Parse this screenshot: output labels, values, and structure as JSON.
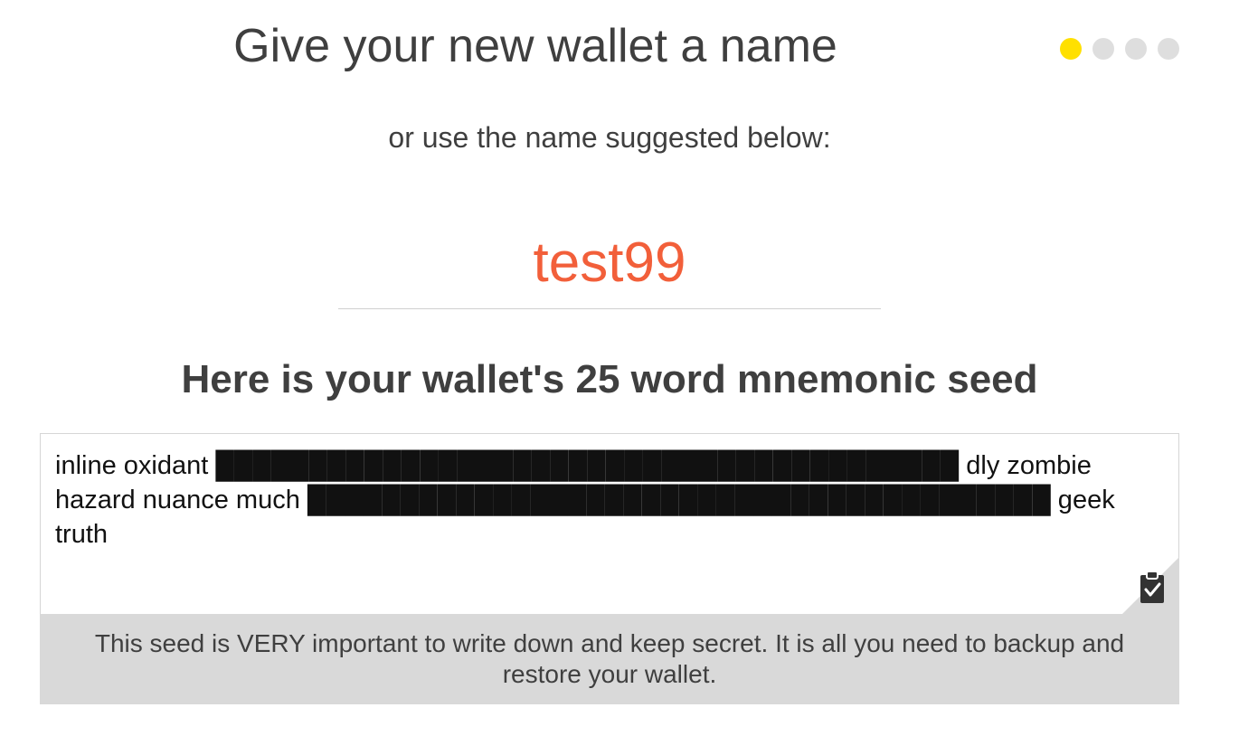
{
  "header": {
    "title": "Give your new wallet a name",
    "subtitle": "or use the name suggested below:"
  },
  "progress": {
    "total_steps": 4,
    "current_step": 1,
    "active_color": "#ffe000",
    "inactive_color": "#dedede"
  },
  "wallet_name": {
    "value": "test99",
    "color": "#f25f3a"
  },
  "seed": {
    "heading": "Here is your wallet's 25 word mnemonic seed",
    "text": "inline oxidant ████████████████████████████████████████ dly zombie hazard nuance much ████████████████████████████████████████ geek truth",
    "copy_icon": "clipboard-check-icon",
    "warning": "This seed is VERY important to write down and keep secret. It is all you need to backup and restore your wallet."
  }
}
